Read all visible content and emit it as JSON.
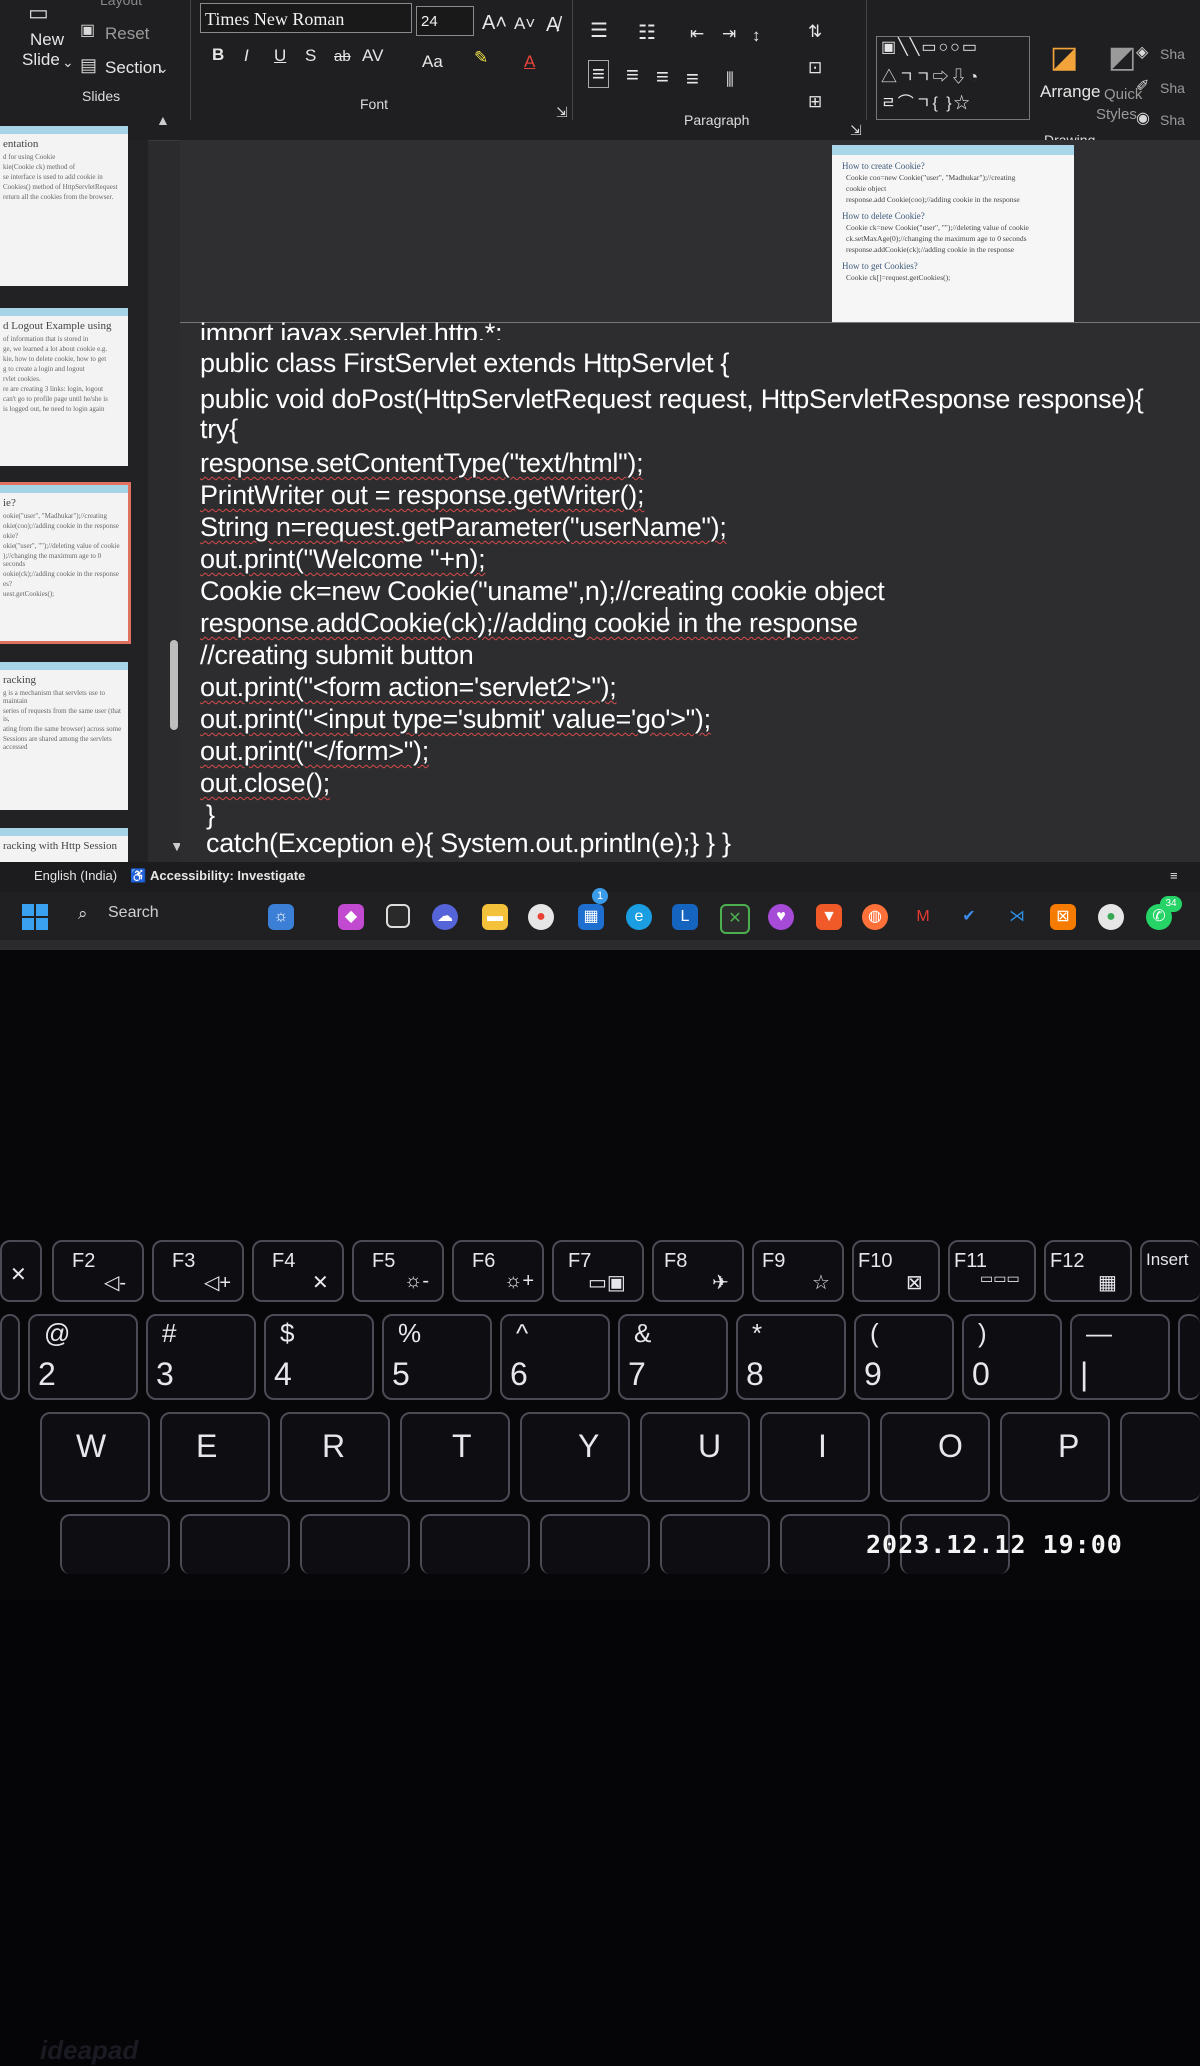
{
  "ribbon": {
    "new_slide": "New",
    "slide_label": "Slide",
    "reset": "Reset",
    "section": "Section",
    "slides_group": "Slides",
    "font_name": "Times New Roman",
    "font_size": "24",
    "font_group": "Font",
    "paragraph_group": "Paragraph",
    "arrange": "Arrange",
    "quick": "Quick",
    "styles": "Styles",
    "drawing_group": "Drawing",
    "sha1": "Sha",
    "sha2": "Sha",
    "sha3": "Sha",
    "layout": "Layout"
  },
  "thumbnails": [
    {
      "title": "entation",
      "lines": [
        "d for using Cookie",
        "kie(Cookie ck) method of",
        "se interface is used to add cookie in",
        "Cookies() method of HttpServletRequest",
        "return all the cookies from the browser."
      ]
    },
    {
      "title": "d Logout Example using",
      "lines": [
        "of information that is stored in",
        "ge, we learned a lot about cookie e.g.",
        "kie, how to delete cookie, how to get",
        "g to create a login and logout",
        "rvlet cookies.",
        "re are creating 3 links: login, logout",
        "can't go to profile page until he/she is",
        "is logged out, he need to login again"
      ]
    },
    {
      "title": "ie?",
      "lines": [
        "ookie(\"user\", \"Madhukar\");//creating",
        "okie(coo);//adding cookie in the response",
        "okie?",
        "okie(\"user\", \"\");//deleting value of cookie",
        ");//changing the maximum age to 0 seconds",
        "ookie(ck);//adding cookie in the response",
        "es?",
        "uest.getCookies();"
      ]
    },
    {
      "title": "racking",
      "lines": [
        "g is a mechanism that servlets use to maintain",
        "series of requests from the same user (that is,",
        "ating from the same browser) across some",
        "Sessions are shared among the servlets accessed"
      ]
    },
    {
      "title": "racking with Http Session",
      "lines": []
    }
  ],
  "preview": {
    "h1": "How to create Cookie?",
    "l1": "Cookie coo=new Cookie(\"user\", \"Madhukar\");//creating",
    "l2": "cookie object",
    "l3": "response.add Cookie(coo);//adding cookie in the response",
    "h2": "How to delete Cookie?",
    "l4": "Cookie ck=new Cookie(\"user\", \"\");//deleting value of cookie",
    "l5": "ck.setMaxAge(0);//changing the maximum age to 0 seconds",
    "l6": "response.addCookie(ck);//adding cookie in the response",
    "h3": "How to get Cookies?",
    "l7": "Cookie ck[]=request.getCookies();"
  },
  "code": {
    "l0": "import javax.servlet.http.*;",
    "l1": "public class FirstServlet extends HttpServlet {",
    "l2": "public void doPost(HttpServletRequest request, HttpServletResponse response){",
    "l3": "try{",
    "l4": "response.setContentType(\"text/html\");",
    "l5": "PrintWriter out = response.getWriter();",
    "l6": "String n=request.getParameter(\"userName\");",
    "l7": "out.print(\"Welcome \"+n);",
    "l8": "Cookie ck=new Cookie(\"uname\",n);//creating cookie object",
    "l9": "response.addCookie(ck);//adding cookie in the response",
    "l10": "//creating submit button",
    "l11": "out.print(\"<form action='servlet2'>\");",
    "l12": "out.print(\"<input type='submit' value='go'>\");",
    "l13": "out.print(\"</form>\");",
    "l14": "out.close();",
    "l15": "}",
    "l16": "catch(Exception e){ System.out.println(e);} } }"
  },
  "status": {
    "language": "English (India)",
    "accessibility": "Accessibility: Investigate"
  },
  "taskbar": {
    "search": "Search",
    "badge_store": "1",
    "badge_whatsapp": "34"
  },
  "keyboard": {
    "fkeys": [
      "F2",
      "F3",
      "F4",
      "F5",
      "F6",
      "F7",
      "F8",
      "F9",
      "F10",
      "F11",
      "F12",
      "Insert"
    ],
    "num_top": [
      "@",
      "#",
      "$",
      "%",
      "^",
      "&",
      "*",
      "(",
      ")",
      "—"
    ],
    "num_bottom": [
      "2",
      "3",
      "4",
      "5",
      "6",
      "7",
      "8",
      "9",
      "0",
      "|"
    ],
    "letters": [
      "W",
      "E",
      "R",
      "T",
      "Y",
      "U",
      "I",
      "O",
      "P"
    ],
    "brand": "ideapad"
  },
  "timestamp": "2023.12.12 19:00"
}
